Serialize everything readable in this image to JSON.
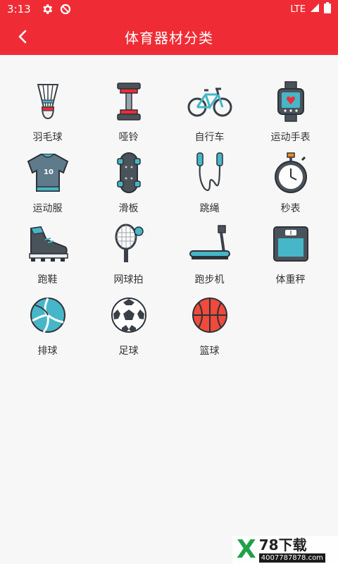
{
  "status_bar": {
    "time": "3:13",
    "network": "LTE"
  },
  "app_bar": {
    "title": "体育器材分类"
  },
  "categories": [
    {
      "label": "羽毛球",
      "icon": "shuttlecock-icon"
    },
    {
      "label": "哑铃",
      "icon": "dumbbell-icon"
    },
    {
      "label": "自行车",
      "icon": "bicycle-icon"
    },
    {
      "label": "运动手表",
      "icon": "smartwatch-icon"
    },
    {
      "label": "运动服",
      "icon": "jersey-icon"
    },
    {
      "label": "滑板",
      "icon": "skateboard-icon"
    },
    {
      "label": "跳绳",
      "icon": "jump-rope-icon"
    },
    {
      "label": "秒表",
      "icon": "stopwatch-icon"
    },
    {
      "label": "跑鞋",
      "icon": "running-shoe-icon"
    },
    {
      "label": "网球拍",
      "icon": "tennis-racket-icon"
    },
    {
      "label": "跑步机",
      "icon": "treadmill-icon"
    },
    {
      "label": "体重秤",
      "icon": "scale-icon"
    },
    {
      "label": "排球",
      "icon": "volleyball-icon"
    },
    {
      "label": "足球",
      "icon": "soccer-ball-icon"
    },
    {
      "label": "篮球",
      "icon": "basketball-icon"
    }
  ],
  "watermark": {
    "title": "78下载",
    "number": "4007787878.com"
  },
  "colors": {
    "accent": "#ef2c35",
    "icon_teal": "#46b6c8",
    "icon_dark": "#3a4047"
  }
}
